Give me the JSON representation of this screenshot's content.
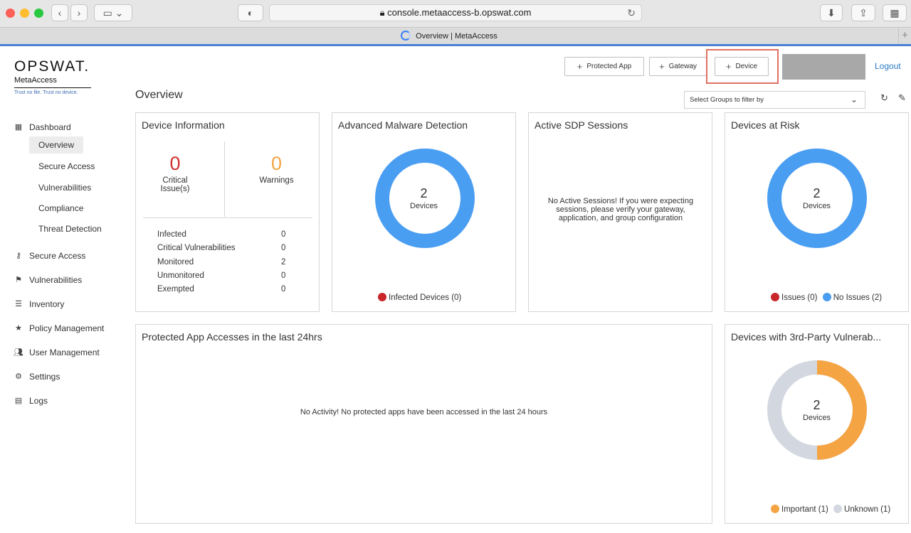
{
  "browser": {
    "url": "console.metaaccess-b.opswat.com",
    "tab_title": "Overview | MetaAccess"
  },
  "header": {
    "brand": "OPSWAT.",
    "product": "MetaAccess",
    "tagline": "Trust no file. Trust no device.",
    "btn_protected_app": "Protected App",
    "btn_gateway": "Gateway",
    "btn_device": "Device",
    "logout": "Logout"
  },
  "page": {
    "title": "Overview",
    "group_filter_placeholder": "Select Groups to filter by"
  },
  "sidebar": {
    "dashboard": "Dashboard",
    "dashboard_sub": [
      "Overview",
      "Secure Access",
      "Vulnerabilities",
      "Compliance",
      "Threat Detection"
    ],
    "items": [
      "Secure Access",
      "Vulnerabilities",
      "Inventory",
      "Policy Management",
      "User Management",
      "Settings",
      "Logs"
    ]
  },
  "device_info": {
    "title": "Device Information",
    "critical_count": "0",
    "critical_label": "Critical Issue(s)",
    "warnings_count": "0",
    "warnings_label": "Warnings",
    "rows": [
      {
        "label": "Infected",
        "value": "0"
      },
      {
        "label": "Critical Vulnerabilities",
        "value": "0"
      },
      {
        "label": "Monitored",
        "value": "2"
      },
      {
        "label": "Unmonitored",
        "value": "0"
      },
      {
        "label": "Exempted",
        "value": "0"
      }
    ]
  },
  "malware": {
    "title": "Advanced Malware Detection",
    "count": "2",
    "unit": "Devices",
    "legend_infected": "Infected Devices (0)"
  },
  "sdp": {
    "title": "Active SDP Sessions",
    "message": "No Active Sessions! If you were expecting sessions, please verify your gateway, application, and group configuration"
  },
  "risk": {
    "title": "Devices at Risk",
    "count": "2",
    "unit": "Devices",
    "legend_issues": "Issues (0)",
    "legend_no_issues": "No Issues (2)"
  },
  "app_access": {
    "title": "Protected App Accesses in the last 24hrs",
    "message": "No Activity! No protected apps have been accessed in the last 24 hours"
  },
  "vuln": {
    "title": "Devices with 3rd-Party Vulnerab...",
    "count": "2",
    "unit": "Devices",
    "legend_important": "Important (1)",
    "legend_unknown": "Unknown (1)"
  },
  "colors": {
    "donut_blue": "#4a9ef2",
    "donut_orange": "#f5a444",
    "donut_gray": "#d3d8e0",
    "critical_red": "#d0312d",
    "warning_orange": "#f3a545",
    "legend_red": "#c9262b",
    "link_blue": "#2a7ac4"
  }
}
